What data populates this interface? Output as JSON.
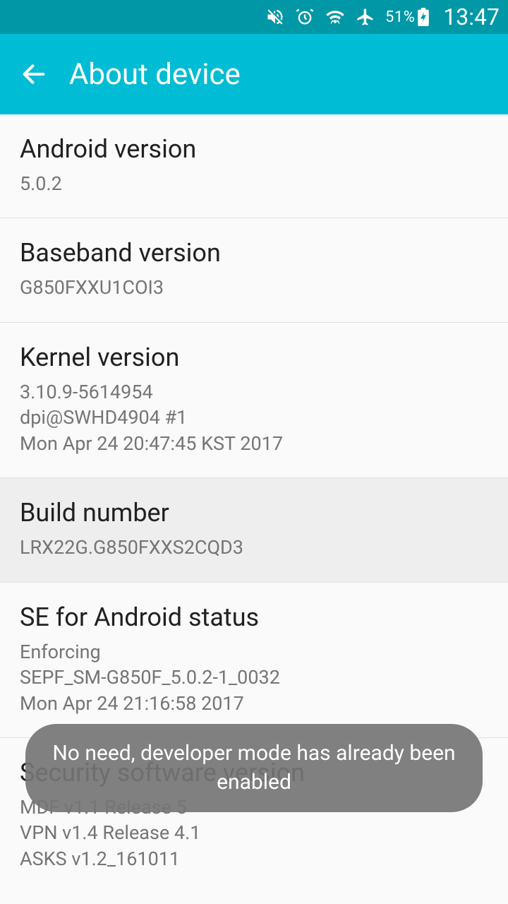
{
  "status": {
    "battery_pct": "51%",
    "clock": "13:47"
  },
  "appbar": {
    "title": "About device"
  },
  "items": [
    {
      "label": "Android version",
      "value": "5.0.2"
    },
    {
      "label": "Baseband version",
      "value": "G850FXXU1COI3"
    },
    {
      "label": "Kernel version",
      "value": "3.10.9-5614954\ndpi@SWHD4904 #1\nMon Apr 24 20:47:45 KST 2017"
    },
    {
      "label": "Build number",
      "value": "LRX22G.G850FXXS2CQD3"
    },
    {
      "label": "SE for Android status",
      "value": "Enforcing\nSEPF_SM-G850F_5.0.2-1_0032\nMon Apr 24 21:16:58 2017"
    },
    {
      "label": "Security software version",
      "value": "MDF v1.1 Release 5\nVPN v1.4 Release 4.1\nASKS v1.2_161011"
    }
  ],
  "toast": "No need, developer mode has already been enabled"
}
